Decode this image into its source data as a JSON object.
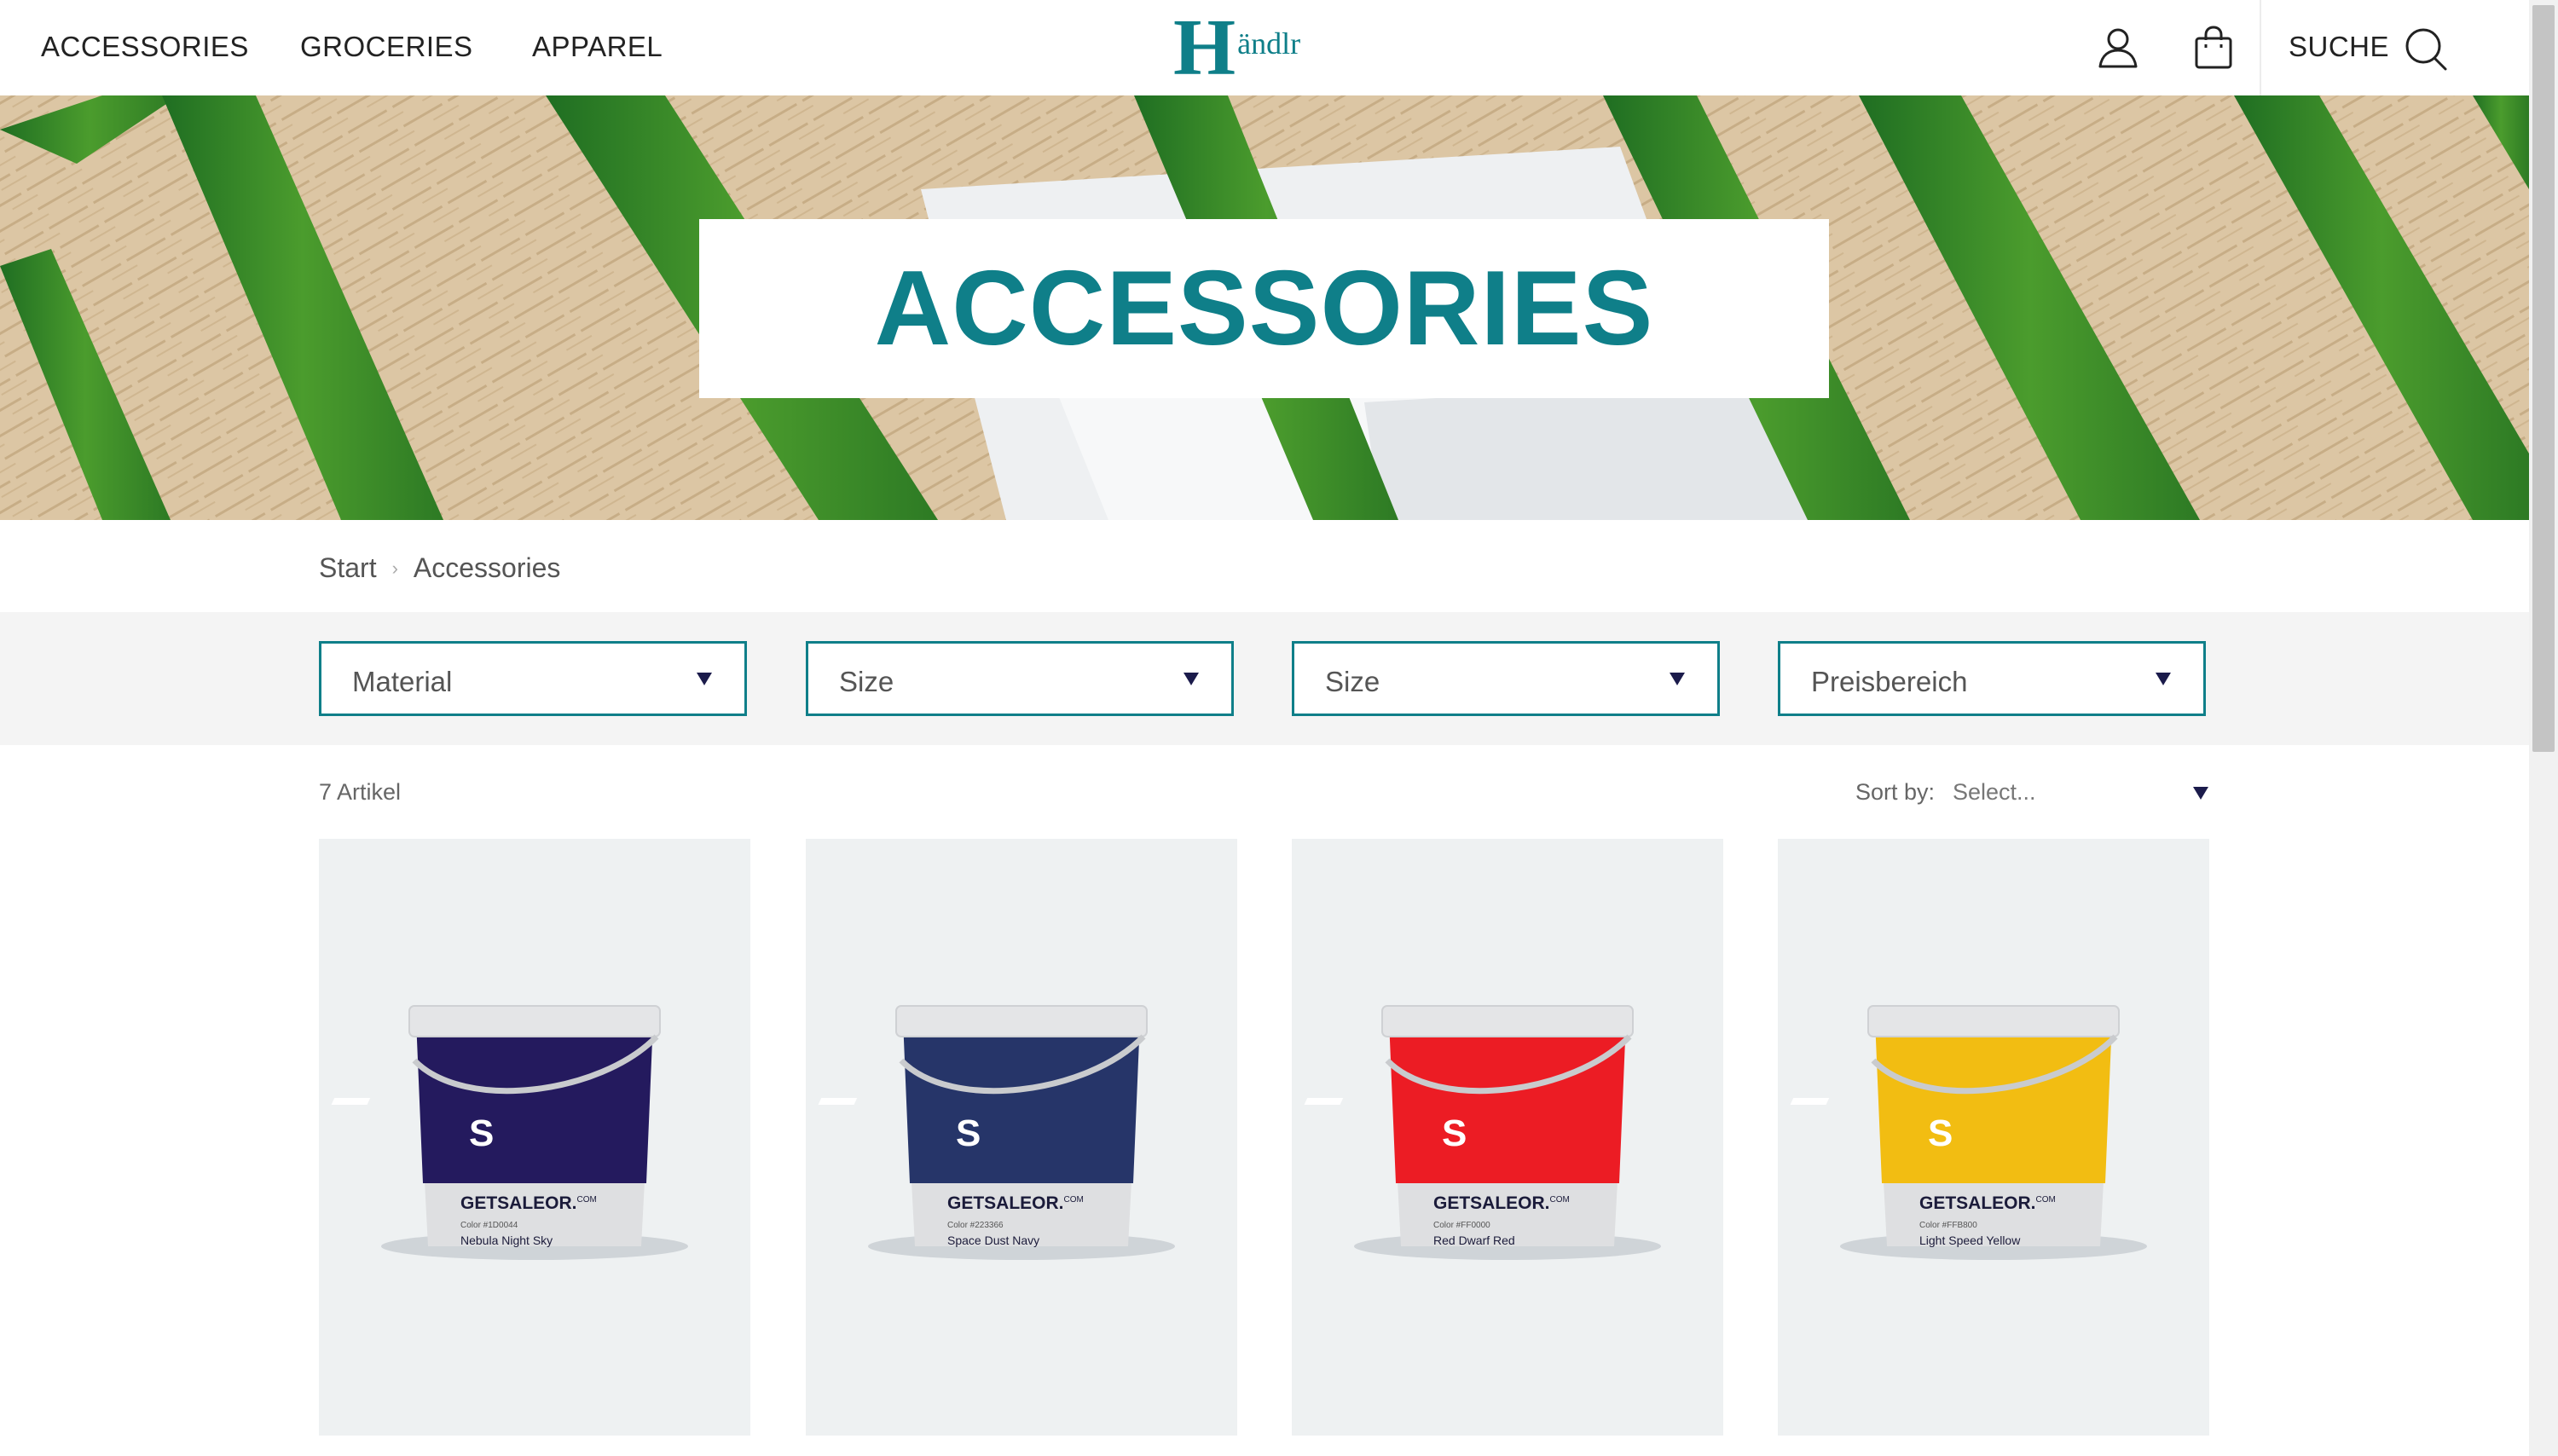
{
  "nav": {
    "links": [
      "ACCESSORIES",
      "GROCERIES",
      "APPAREL"
    ],
    "logo_initial": "H",
    "logo_rest": "ändlr",
    "search_label": "SUCHE",
    "icons": [
      "user-icon",
      "shopping-bag-icon",
      "search-icon"
    ]
  },
  "hero": {
    "title": "ACCESSORIES"
  },
  "breadcrumb": {
    "items": [
      "Start",
      "Accessories"
    ]
  },
  "filters": [
    {
      "label": "Material"
    },
    {
      "label": "Size"
    },
    {
      "label": "Size"
    },
    {
      "label": "Preisbereich"
    }
  ],
  "listing": {
    "count": "7 Artikel",
    "sort_label": "Sort by:",
    "sort_value": "Select..."
  },
  "products": [
    {
      "brand": "GETSALEOR.",
      "brand_sup": "COM",
      "color_code": "Color #1D0044",
      "name": "Nebula Night Sky",
      "color": "#241a5e"
    },
    {
      "brand": "GETSALEOR.",
      "brand_sup": "COM",
      "color_code": "Color #223366",
      "name": "Space Dust Navy",
      "color": "#263569"
    },
    {
      "brand": "GETSALEOR.",
      "brand_sup": "COM",
      "color_code": "Color #FF0000",
      "name": "Red Dwarf Red",
      "color": "#ec1c24"
    },
    {
      "brand": "GETSALEOR.",
      "brand_sup": "COM",
      "color_code": "Color #FFB800",
      "name": "Light Speed Yellow",
      "color": "#f2bd12"
    }
  ],
  "colors": {
    "accent": "#0f7f89",
    "caret": "#1b1b4b",
    "filter_bg": "#f4f4f4",
    "card_bg": "#eef1f2"
  }
}
